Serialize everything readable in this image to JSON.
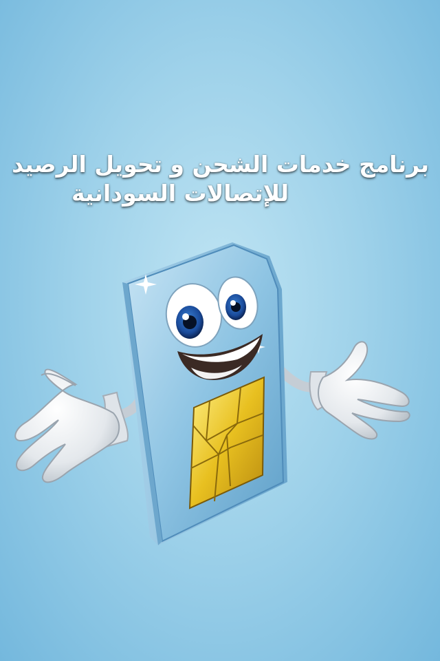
{
  "splash": {
    "title_line1": "برنامج خدمات الشحن و تحويل الرصيد",
    "title_line2": "للإتصالات السودانية"
  },
  "mascot": {
    "icon": "sim-card-mascot-icon",
    "chip_color": "#e8c020",
    "body_color": "#8cc3e3"
  }
}
